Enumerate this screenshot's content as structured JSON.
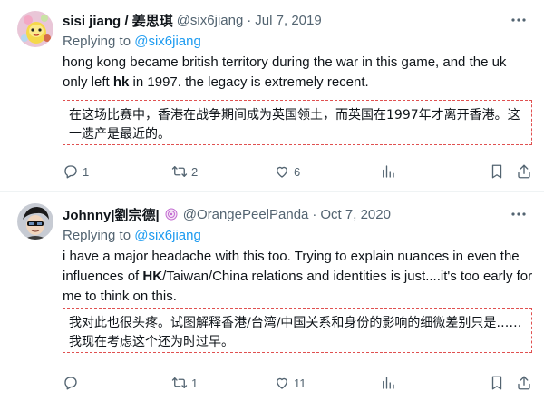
{
  "colors": {
    "accent": "#1d9bf0",
    "muted": "#536471",
    "text": "#0f1419",
    "translation_border": "#e05050"
  },
  "tweets": [
    {
      "name": "sisi jiang / 姜思琪",
      "handle": "@six6jiang",
      "separator": "·",
      "date": "Jul 7, 2019",
      "replying_prefix": "Replying to ",
      "replying_to": "@six6jiang",
      "body_1": "hong kong became british territory during the war in this game, and the uk only left ",
      "body_bold": "hk",
      "body_2": " in 1997. the legacy is extremely recent.",
      "translation": "在这场比赛中，香港在战争期间成为英国领土，而英国在1997年才离开香港。这一遗产是最近的。",
      "reply_count": "1",
      "retweet_count": "2",
      "like_count": "6",
      "icons": [
        "reply-icon",
        "retweet-icon",
        "like-icon",
        "views-icon",
        "bookmark-icon",
        "share-icon",
        "more-icon"
      ]
    },
    {
      "name": "Johnny|劉宗德|",
      "handle": "@OrangePeelPanda",
      "separator": "·",
      "date": "Oct 7, 2020",
      "replying_prefix": "Replying to ",
      "replying_to": "@six6jiang",
      "body_1": "i have a major headache with this too. Trying to explain nuances in even the influences of ",
      "body_bold": "HK",
      "body_2": "/Taiwan/China relations and identities is just....it's too early for me to think on this.",
      "translation": "我对此也很头疼。试图解释香港/台湾/中国关系和身份的影响的细微差别只是……我现在考虑这个还为时过早。",
      "reply_count": "",
      "retweet_count": "1",
      "like_count": "11",
      "icons": [
        "reply-icon",
        "retweet-icon",
        "like-icon",
        "views-icon",
        "bookmark-icon",
        "share-icon",
        "more-icon"
      ]
    }
  ]
}
